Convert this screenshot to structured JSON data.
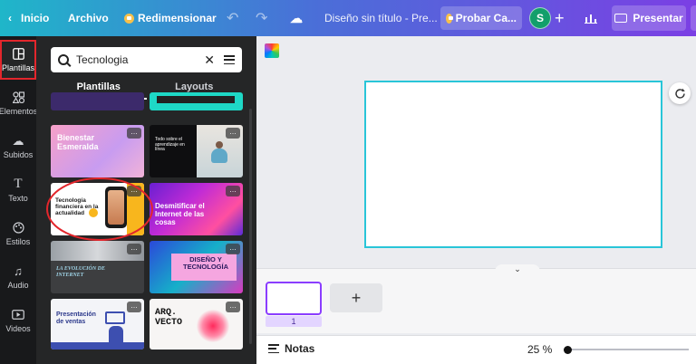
{
  "topbar": {
    "home": "Inicio",
    "file": "Archivo",
    "resize": "Redimensionar",
    "title": "Diseño sin título - Pre...",
    "try": "Probar Ca...",
    "avatar": "S",
    "present": "Presentar"
  },
  "rail": {
    "items": [
      {
        "label": "Plantillas",
        "icon": "template-icon"
      },
      {
        "label": "Elementos",
        "icon": "elements-icon"
      },
      {
        "label": "Subidos",
        "icon": "upload-cloud-icon"
      },
      {
        "label": "Texto",
        "icon": "text-icon"
      },
      {
        "label": "Estilos",
        "icon": "palette-icon"
      },
      {
        "label": "Audio",
        "icon": "music-icon"
      },
      {
        "label": "Videos",
        "icon": "video-icon"
      }
    ]
  },
  "panel": {
    "search_value": "Tecnologia",
    "tabs": [
      "Plantillas",
      "Layouts"
    ],
    "templates": [
      {
        "title": "Bienestar Esmeralda"
      },
      {
        "title": "Todo sobre el aprendizaje en línea"
      },
      {
        "title": "Tecnología financiera en la actualidad"
      },
      {
        "title": "Desmitificar el Internet de las cosas"
      },
      {
        "title": "LA EVOLUCIÓN DE INTERNET"
      },
      {
        "title": "DISEÑO Y TECNOLOGÍA"
      },
      {
        "title": "Presentación de ventas"
      },
      {
        "title": "ARQ. VECTO"
      }
    ]
  },
  "editor": {
    "page_number": "1",
    "notes": "Notas",
    "zoom": "25 %"
  },
  "colors": {
    "accent": "#8b3dff",
    "canvas_border": "#29c5d8",
    "highlight": "#e3262c"
  }
}
